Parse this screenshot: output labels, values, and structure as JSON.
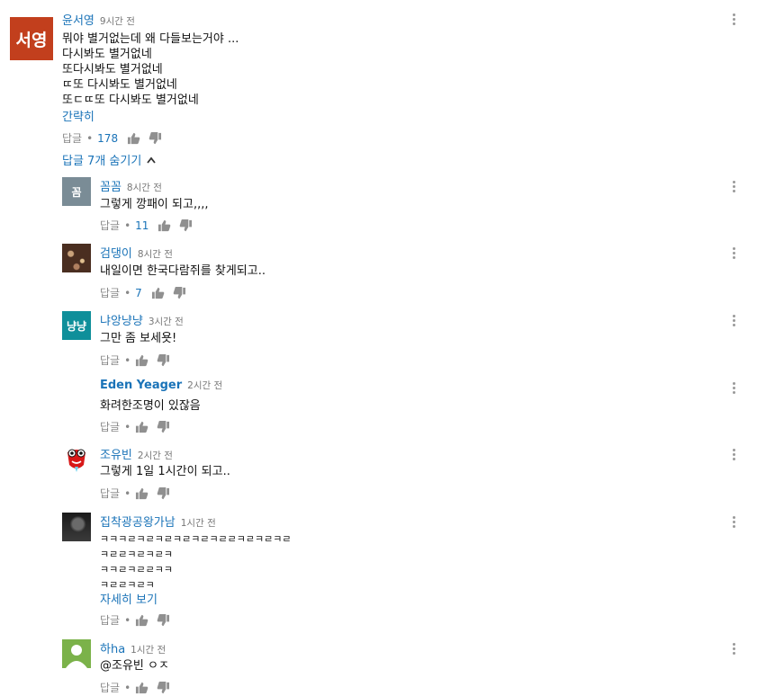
{
  "main_comment": {
    "avatar_text": "서영",
    "avatar_color": "#c23f1d",
    "author": "윤서영",
    "time": "9시간 전",
    "lines": [
      "뭐야 별거없는데 왜 다들보는거야 ...",
      "다시봐도 별거없네",
      "또다시봐도 별거없네",
      "ㄸ또 다시봐도 별거없네",
      "또ㄷㄸ또 다시봐도 별거없네"
    ],
    "collapse_label": "간략히",
    "reply_label": "답글",
    "dot": "•",
    "likes": "178"
  },
  "hide_replies_label": "답글 7개 숨기기",
  "replies": [
    {
      "avatar_text": "꼼",
      "avatar_color": "#7a8c96",
      "author": "꼼꼼",
      "time": "8시간 전",
      "lines": [
        "그렇게 깡패이 되고,,,,"
      ],
      "reply_label": "답글",
      "dot": "•",
      "likes": "11"
    },
    {
      "avatar_text": "",
      "avatar_color": "#5a3a2a",
      "author": "검댕이",
      "time": "8시간 전",
      "lines": [
        "내일이면 한국다람쥐를 찾게되고.."
      ],
      "reply_label": "답글",
      "dot": "•",
      "likes": "7"
    },
    {
      "avatar_text": "냥냥",
      "avatar_color": "#0f8f9a",
      "author": "냐앙냥냥",
      "time": "3시간 전",
      "lines": [
        "그만 좀 보세욧!"
      ],
      "reply_label": "답글",
      "dot": "•",
      "likes": ""
    },
    {
      "avatar_text": "",
      "avatar_color": "",
      "author": "Eden Yeager",
      "time": "2시간 전",
      "lines": [
        "화려한조명이 있잖음"
      ],
      "reply_label": "답글",
      "dot": "•",
      "likes": ""
    },
    {
      "avatar_text": "",
      "avatar_color": "#ffffff",
      "author": "조유빈",
      "time": "2시간 전",
      "lines": [
        "그렇게 1일 1시간이 되고.."
      ],
      "reply_label": "답글",
      "dot": "•",
      "likes": ""
    },
    {
      "avatar_text": "",
      "avatar_color": "#2b2b2b",
      "author": "집착광공왕가남",
      "time": "1시간 전",
      "lines": [
        "ㅋㅋㅋㄹㅋㄹㅋㄹㅋㄹㅋㄹㅋㄹㄹㅋㄹㅋㄹㅋㄹ",
        "ㅋㄹㄹㅋㄹㅋㄹㅋ",
        "ㅋㅋㄹㅋㄹㄹㅋㅋ",
        "ㅋㄹㄹㅋㄹㅋ"
      ],
      "expand_label": "자세히 보기",
      "reply_label": "답글",
      "dot": "•",
      "likes": ""
    },
    {
      "avatar_text": "",
      "avatar_color": "#7bb24a",
      "author": "하ha",
      "time": "1시간 전",
      "lines": [
        "@조유빈 ㅇㅈ"
      ],
      "reply_label": "답글",
      "dot": "•",
      "likes": ""
    }
  ]
}
